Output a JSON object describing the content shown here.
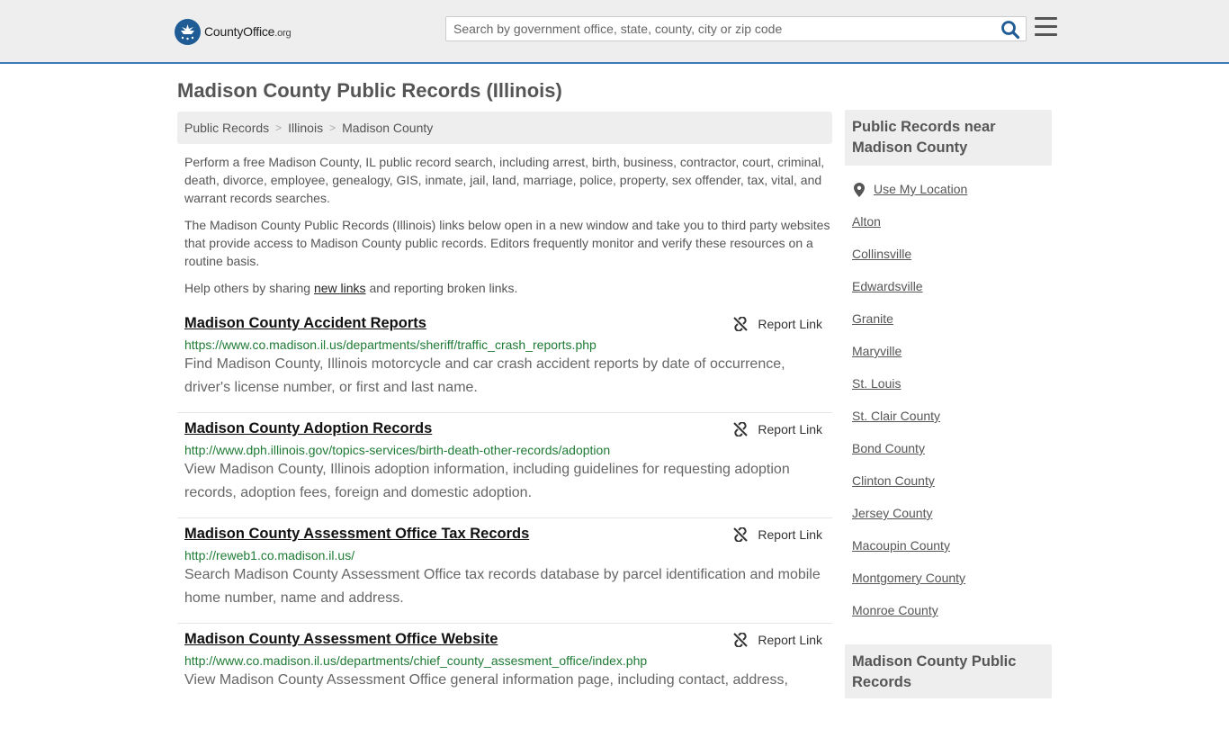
{
  "header": {
    "brand_name": "CountyOffice",
    "brand_tld": ".org",
    "search_placeholder": "Search by government office, state, county, city or zip code",
    "search_value": ""
  },
  "page": {
    "title": "Madison County Public Records (Illinois)"
  },
  "breadcrumb": [
    "Public Records",
    "Illinois",
    "Madison County"
  ],
  "intro": {
    "p1": "Perform a free Madison County, IL public record search, including arrest, birth, business, contractor, court, criminal, death, divorce, employee, genealogy, GIS, inmate, jail, land, marriage, police, property, sex offender, tax, vital, and warrant records searches.",
    "p2": "The Madison County Public Records (Illinois) links below open in a new window and take you to third party websites that provide access to Madison County public records. Editors frequently monitor and verify these resources on a routine basis.",
    "p3_before": "Help others by sharing ",
    "p3_link": "new links",
    "p3_after": " and reporting broken links."
  },
  "report_label": "Report Link",
  "records": [
    {
      "title": "Madison County Accident Reports",
      "url": "https://www.co.madison.il.us/departments/sheriff/traffic_crash_reports.php",
      "desc": "Find Madison County, Illinois motorcycle and car crash accident reports by date of occurrence, driver's license number, or first and last name."
    },
    {
      "title": "Madison County Adoption Records",
      "url": "http://www.dph.illinois.gov/topics-services/birth-death-other-records/adoption",
      "desc": "View Madison County, Illinois adoption information, including guidelines for requesting adoption records, adoption fees, foreign and domestic adoption."
    },
    {
      "title": "Madison County Assessment Office Tax Records",
      "url": "http://reweb1.co.madison.il.us/",
      "desc": "Search Madison County Assessment Office tax records database by parcel identification and mobile home number, name and address."
    },
    {
      "title": "Madison County Assessment Office Website",
      "url": "http://www.co.madison.il.us/departments/chief_county_assesment_office/index.php",
      "desc": "View Madison County Assessment Office general information page, including contact, address,"
    }
  ],
  "sidebar": {
    "heading": "Public Records near Madison County",
    "use_location": "Use My Location",
    "places": [
      "Alton",
      "Collinsville",
      "Edwardsville",
      "Granite",
      "Maryville",
      "St. Louis",
      "St. Clair County",
      "Bond County",
      "Clinton County",
      "Jersey County",
      "Macoupin County",
      "Montgomery County",
      "Monroe County"
    ],
    "heading2": "Madison County Public Records"
  },
  "colors": {
    "accent": "#3d7ab8",
    "url_green": "#1e7b34",
    "search_icon": "#1f5b94"
  }
}
